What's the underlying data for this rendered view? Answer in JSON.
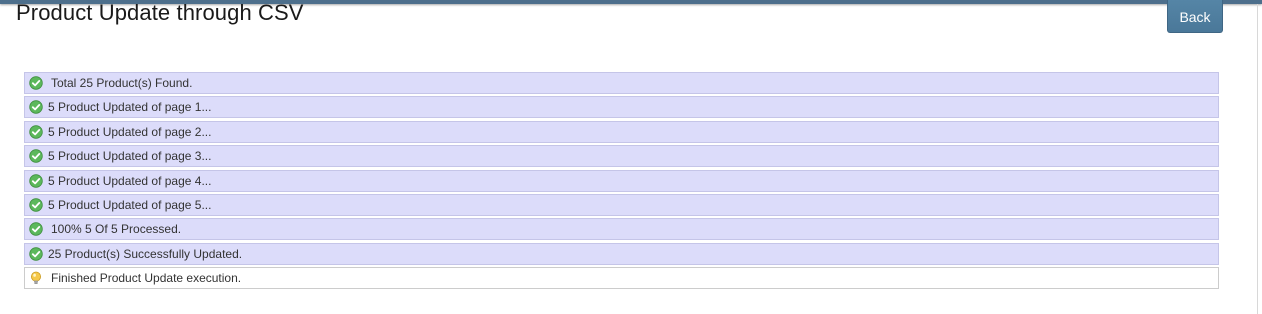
{
  "page": {
    "title": "Product Update through CSV",
    "back_label": "Back"
  },
  "log": [
    {
      "icon": "check-circle-icon",
      "text": "Total 25 Product(s) Found.",
      "status": "success"
    },
    {
      "icon": "check-circle-icon",
      "text": "5 Product Updated of page 1...",
      "status": "success"
    },
    {
      "icon": "check-circle-icon",
      "text": "5 Product Updated of page 2...",
      "status": "success"
    },
    {
      "icon": "check-circle-icon",
      "text": "5 Product Updated of page 3...",
      "status": "success"
    },
    {
      "icon": "check-circle-icon",
      "text": "5 Product Updated of page 4...",
      "status": "success"
    },
    {
      "icon": "check-circle-icon",
      "text": "5 Product Updated of page 5...",
      "status": "success"
    },
    {
      "icon": "check-circle-icon",
      "text": "100% 5 Of 5 Processed.",
      "status": "success"
    },
    {
      "icon": "check-circle-icon",
      "text": "25 Product(s) Successfully Updated.",
      "status": "success"
    },
    {
      "icon": "lightbulb-icon",
      "text": "Finished Product Update execution.",
      "status": "info"
    }
  ],
  "colors": {
    "topbar": "#4d6f8c",
    "button": "#4f7e9f",
    "success_row_bg": "#dcdcfa",
    "success_icon": "#5cb85c",
    "info_icon": "#f0c040"
  }
}
